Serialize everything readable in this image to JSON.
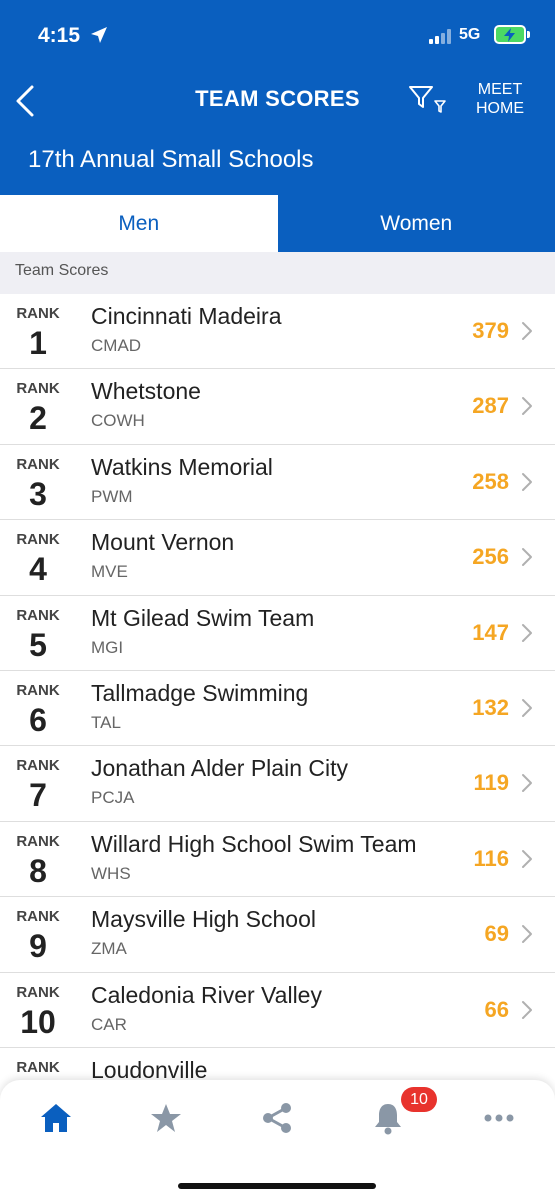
{
  "status": {
    "time": "4:15",
    "network": "5G"
  },
  "header": {
    "title": "TEAM SCORES",
    "meet_home": "MEET HOME",
    "meet_name": "17th Annual Small Schools"
  },
  "tabs": [
    {
      "label": "Men",
      "active": true
    },
    {
      "label": "Women",
      "active": false
    }
  ],
  "section_title": "Team Scores",
  "rank_label": "RANK",
  "teams": [
    {
      "rank": "1",
      "name": "Cincinnati Madeira",
      "code": "CMAD",
      "score": "379"
    },
    {
      "rank": "2",
      "name": "Whetstone",
      "code": "COWH",
      "score": "287"
    },
    {
      "rank": "3",
      "name": "Watkins Memorial",
      "code": "PWM",
      "score": "258"
    },
    {
      "rank": "4",
      "name": "Mount Vernon",
      "code": "MVE",
      "score": "256"
    },
    {
      "rank": "5",
      "name": "Mt Gilead Swim Team",
      "code": "MGI",
      "score": "147"
    },
    {
      "rank": "6",
      "name": "Tallmadge Swimming",
      "code": "TAL",
      "score": "132"
    },
    {
      "rank": "7",
      "name": "Jonathan Alder Plain City",
      "code": "PCJA",
      "score": "119"
    },
    {
      "rank": "8",
      "name": "Willard High School Swim Team",
      "code": "WHS",
      "score": "116"
    },
    {
      "rank": "9",
      "name": "Maysville High School",
      "code": "ZMA",
      "score": "69"
    },
    {
      "rank": "10",
      "name": "Caledonia River Valley",
      "code": "CAR",
      "score": "66"
    },
    {
      "rank": "",
      "name": "Loudonville",
      "code": "",
      "score": ""
    }
  ],
  "notifications_count": "10",
  "colors": {
    "brand_blue": "#0a5fbf",
    "score_orange": "#f5a623",
    "badge_red": "#e8332d"
  },
  "icons": [
    "location-arrow-icon",
    "back-chevron-icon",
    "filter-icon",
    "home-icon",
    "star-icon",
    "share-icon",
    "bell-icon",
    "more-icon",
    "chevron-right-icon"
  ]
}
